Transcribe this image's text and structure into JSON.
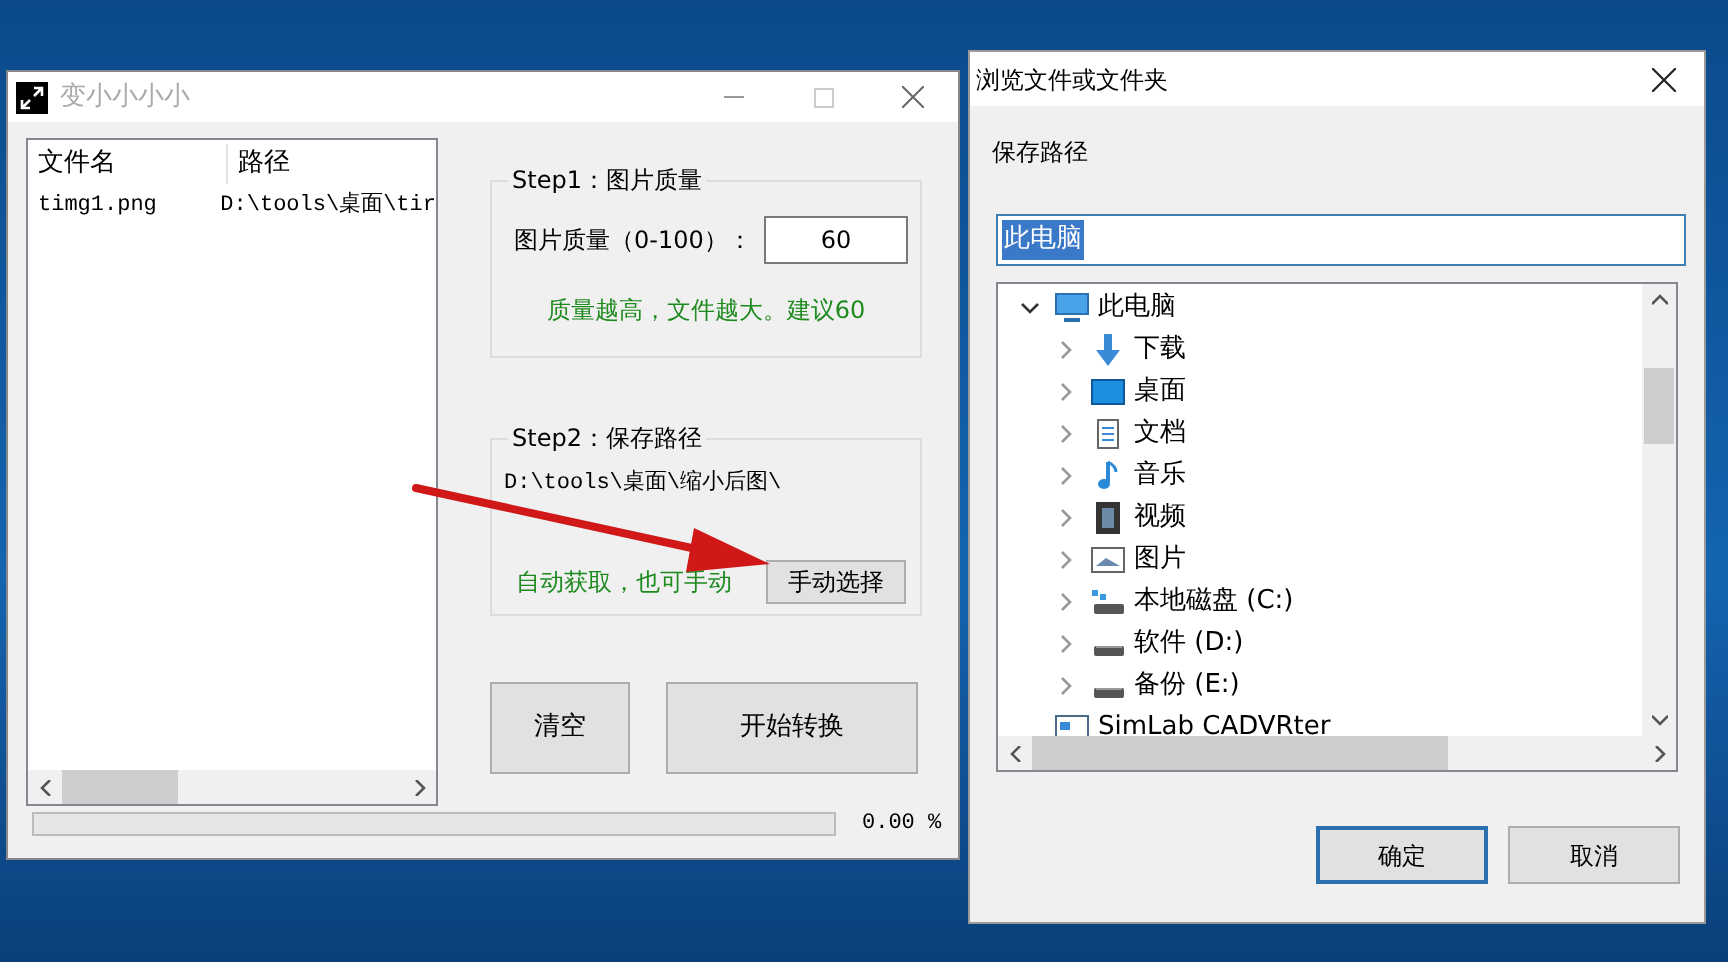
{
  "main_window": {
    "title": "变小小小小",
    "file_list": {
      "columns": [
        "文件名",
        "路径"
      ],
      "rows": [
        {
          "cells": [
            "timg1.png",
            "D:\\tools\\桌面\\tir"
          ]
        }
      ]
    },
    "step1": {
      "title": "Step1：图片质量",
      "field_label": "图片质量（0-100）：",
      "value": "60",
      "hint": "质量越高，文件越大。建议60"
    },
    "step2": {
      "title": "Step2：保存路径",
      "path": "D:\\tools\\桌面\\缩小后图\\",
      "hint": "自动获取，也可手动",
      "button": "手动选择"
    },
    "buttons": [
      "清空",
      "开始转换"
    ],
    "progress": {
      "level": 0,
      "reading": "0.00 %"
    }
  },
  "dialog": {
    "title": "浏览文件或文件夹",
    "prompt": "保存路径",
    "path_field": {
      "value": "此电脑",
      "text_selected": true
    },
    "tree": [
      {
        "label": "此电脑",
        "kind": "computer",
        "expanded": true,
        "children": [
          {
            "label": "下载",
            "kind": "download",
            "expanded": false
          },
          {
            "label": "桌面",
            "kind": "desktop",
            "expanded": false
          },
          {
            "label": "文档",
            "kind": "document",
            "expanded": false
          },
          {
            "label": "音乐",
            "kind": "music",
            "expanded": false
          },
          {
            "label": "视频",
            "kind": "video",
            "expanded": false
          },
          {
            "label": "图片",
            "kind": "picture",
            "expanded": false
          },
          {
            "label": "本地磁盘 (C:)",
            "kind": "system-drive",
            "expanded": false
          },
          {
            "label": "软件 (D:)",
            "kind": "drive",
            "expanded": false
          },
          {
            "label": "备份 (E:)",
            "kind": "drive",
            "expanded": false
          }
        ]
      },
      {
        "label": "SimLab CADVRter",
        "kind": "app"
      }
    ],
    "buttons": [
      {
        "label": "确定",
        "default": true
      },
      {
        "label": "取消",
        "default": false
      }
    ]
  }
}
